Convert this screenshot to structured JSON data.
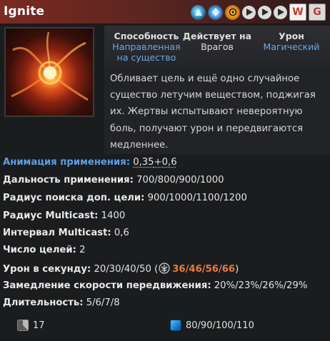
{
  "header": {
    "title": "Ignite",
    "icons": [
      "aghanims-scepter-icon",
      "aghanims-shard-icon",
      "talent-tree-icon",
      "play-icon",
      "play-icon",
      "play-icon"
    ],
    "buttons": {
      "w_label": "W",
      "g_label": "G"
    }
  },
  "ability_info": {
    "ability_label": "Способность",
    "ability_value_line1": "Направленная",
    "ability_value_line2": "на существо",
    "affects_label": "Действует на",
    "affects_value": "Врагов",
    "damage_label": "Урон",
    "damage_value": "Магический"
  },
  "description": "Обливает цель и ещё одно случайное существо летучим веществом, поджигая их. Жертвы испытывают невероятную боль, получают урон и передвигаются медленнее.",
  "stats": {
    "cast_point": {
      "label": "Анимация применения:",
      "value_a": "0,35",
      "value_b": "+0,6"
    },
    "cast_range": {
      "label": "Дальность применения:",
      "value": "700/800/900/1000"
    },
    "search_radius": {
      "label": "Радиус поиска доп. цели:",
      "value": "900/1000/1100/1200"
    },
    "multicast_radius": {
      "label": "Радиус Multicast:",
      "value": "1400"
    },
    "multicast_interval": {
      "label": "Интервал Multicast:",
      "value": "0,6"
    },
    "targets": {
      "label": "Число целей:",
      "value": "2"
    },
    "dps": {
      "label": "Урон в секунду:",
      "value": "20/30/40/50 (",
      "talent_value": "36/46/56/66",
      "close": ")"
    },
    "slow": {
      "label": "Замедление скорости передвижения:",
      "value": "20%/23%/26%/29%"
    },
    "duration": {
      "label": "Длительность:",
      "value": "5/6/7/8"
    }
  },
  "footer": {
    "cooldown_icon": "cooldown-icon",
    "cooldown": "17",
    "mana_icon": "mana-icon",
    "mana": "80/90/100/110"
  },
  "colors": {
    "title_bar": "#7a2a22",
    "accent_blue": "#5d9fe4",
    "talent_orange": "#ec7a3c",
    "mana_blue": "#1e88d6"
  }
}
